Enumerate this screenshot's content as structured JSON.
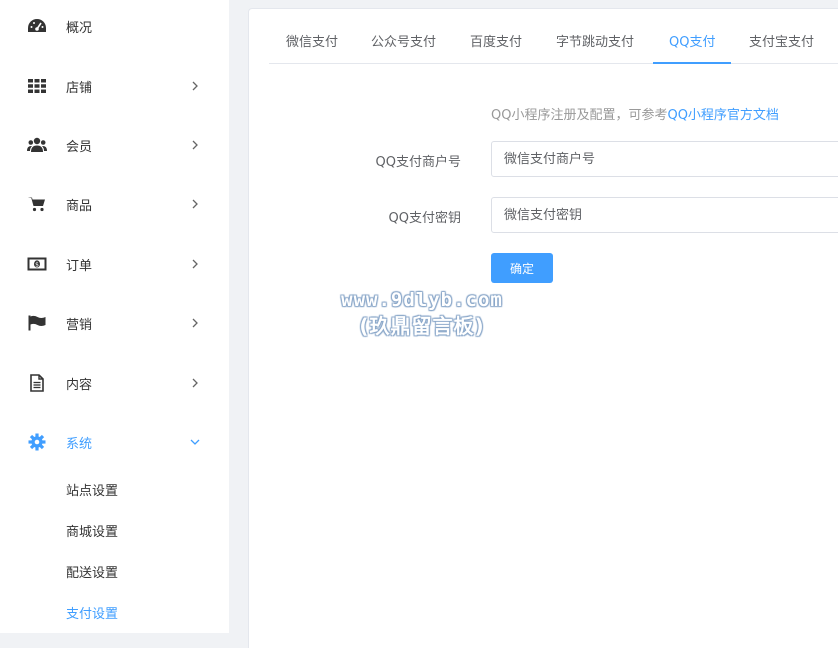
{
  "sidebar": {
    "items": [
      {
        "label": "概况",
        "icon": "dashboard-icon"
      },
      {
        "label": "店铺",
        "icon": "grid-icon"
      },
      {
        "label": "会员",
        "icon": "users-icon"
      },
      {
        "label": "商品",
        "icon": "cart-icon"
      },
      {
        "label": "订单",
        "icon": "money-icon"
      },
      {
        "label": "营销",
        "icon": "flag-icon"
      },
      {
        "label": "内容",
        "icon": "document-icon"
      },
      {
        "label": "系统",
        "icon": "gear-icon"
      }
    ],
    "sub_items": [
      {
        "label": "站点设置"
      },
      {
        "label": "商城设置"
      },
      {
        "label": "配送设置"
      },
      {
        "label": "支付设置"
      }
    ],
    "active_color": "#409eff"
  },
  "tabs": [
    {
      "label": "微信支付"
    },
    {
      "label": "公众号支付"
    },
    {
      "label": "百度支付"
    },
    {
      "label": "字节跳动支付"
    },
    {
      "label": "QQ支付"
    },
    {
      "label": "支付宝支付"
    }
  ],
  "form": {
    "hint_prefix": "QQ小程序注册及配置，可参考",
    "hint_link": "QQ小程序官方文档",
    "merchant_label": "QQ支付商户号",
    "merchant_placeholder": "微信支付商户号",
    "secret_label": "QQ支付密钥",
    "secret_placeholder": "微信支付密钥",
    "submit_label": "确定"
  },
  "watermark": {
    "line1": "www.9dlyb.com",
    "line2": "(玖鼎留言板)"
  }
}
